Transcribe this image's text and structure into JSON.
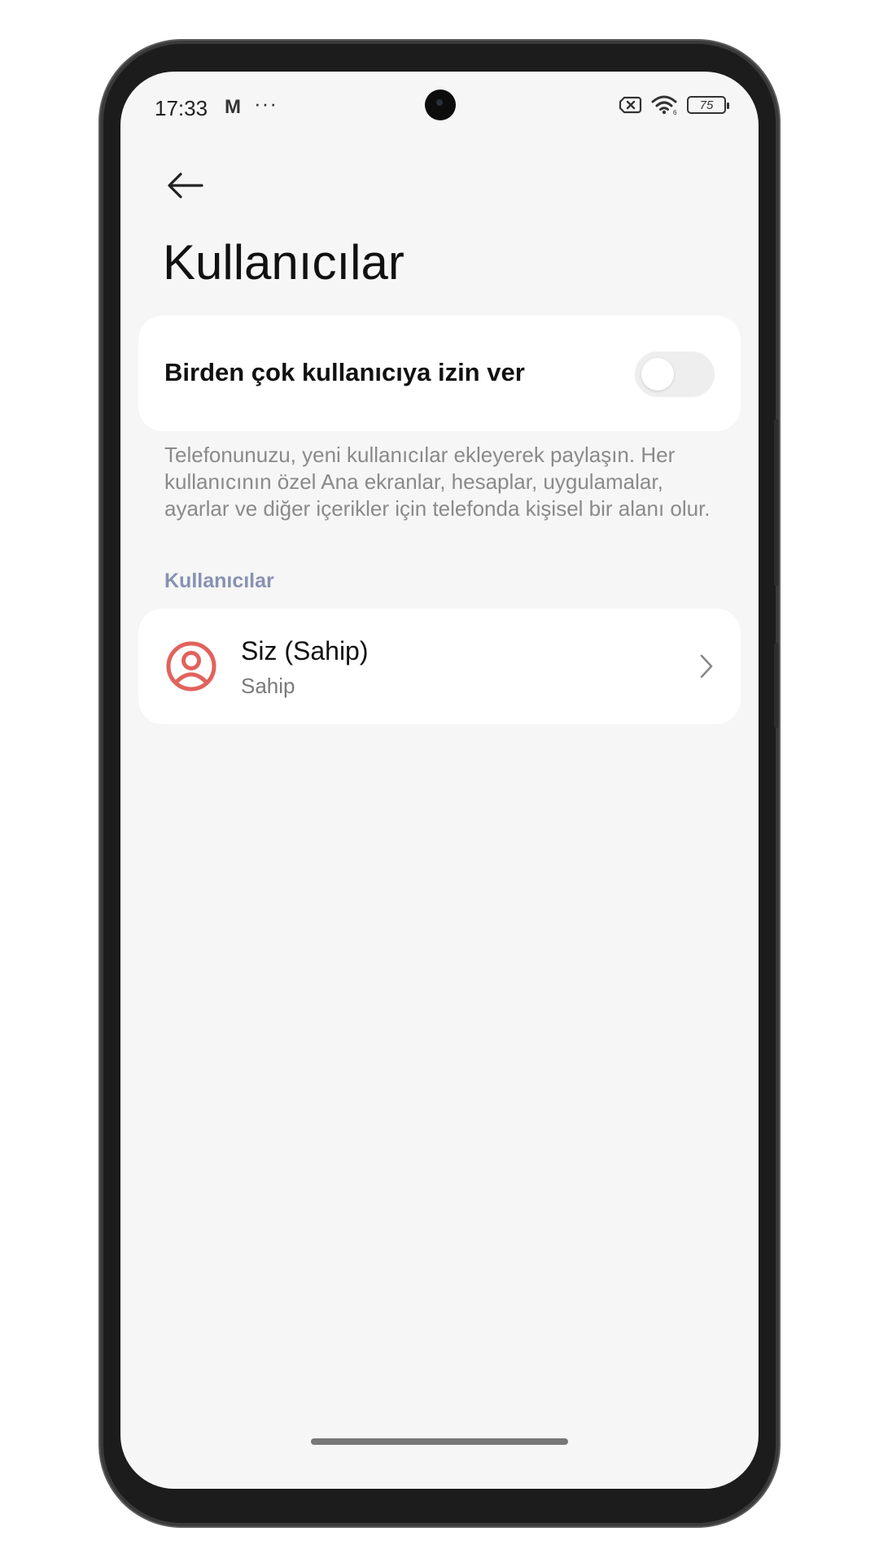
{
  "status_bar": {
    "time": "17:33",
    "mail_icon": "gmail-icon",
    "more_notifications": "···",
    "sim_icon": "no-sim-icon",
    "wifi_icon": "wifi-icon",
    "battery_level": "75"
  },
  "header": {
    "back_icon": "arrow-left-icon",
    "title": "Kullanıcılar"
  },
  "multi_user": {
    "label": "Birden çok kullanıcıya izin ver",
    "enabled": false
  },
  "description": "Telefonunuzu, yeni kullanıcılar ekleyerek paylaşın. Her kullanıcının özel Ana ekranlar, hesaplar, uygulamalar, ayarlar ve diğer içerikler için telefonda kişisel bir alanı olur.",
  "users_section": {
    "header": "Kullanıcılar",
    "items": [
      {
        "name": "Siz (Sahip)",
        "role": "Sahip",
        "icon": "user-avatar-icon",
        "chevron_icon": "chevron-right-icon"
      }
    ]
  },
  "colors": {
    "background": "#f6f6f6",
    "card": "#ffffff",
    "section_header": "#8792b3",
    "avatar": "#e2625c",
    "toggle_off": "#eeeeee"
  }
}
